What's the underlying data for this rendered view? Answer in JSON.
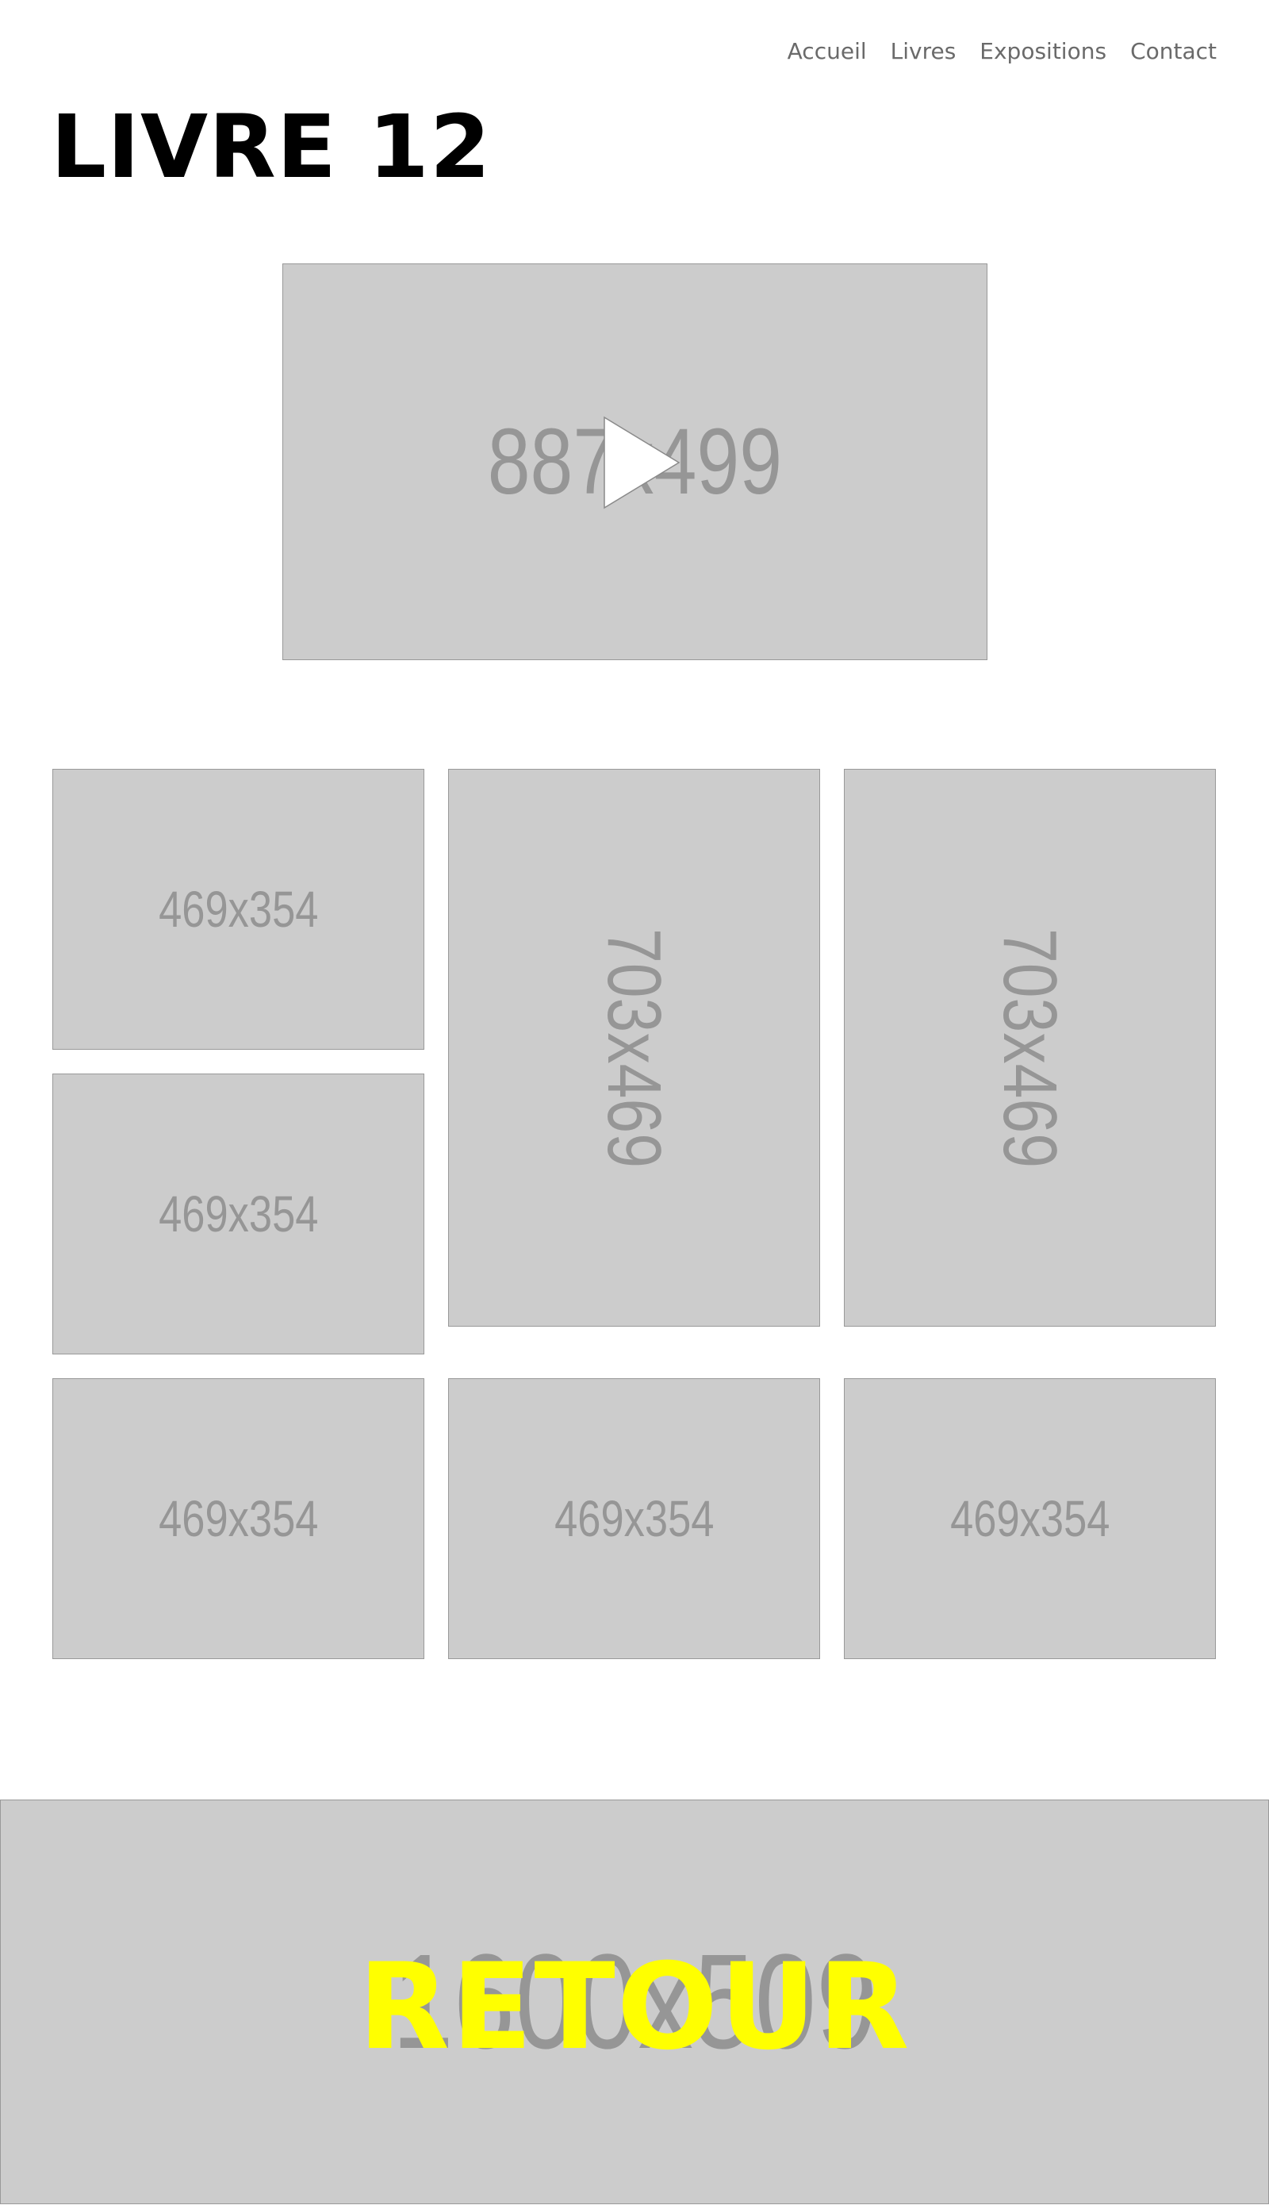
{
  "nav": {
    "items": [
      {
        "label": "Accueil"
      },
      {
        "label": "Livres"
      },
      {
        "label": "Expositions"
      },
      {
        "label": "Contact"
      }
    ]
  },
  "page": {
    "title": "LIVRE 12"
  },
  "video": {
    "placeholder_label": "887x499"
  },
  "gallery": {
    "items": [
      {
        "label": "469x354"
      },
      {
        "label": "703x469"
      },
      {
        "label": "703x469"
      },
      {
        "label": "469x354"
      },
      {
        "label": "469x354"
      },
      {
        "label": "469x354"
      },
      {
        "label": "469x354"
      }
    ]
  },
  "banner": {
    "placeholder_label": "1600x509",
    "link_label": "RETOUR",
    "link_color": "#ffff00"
  },
  "colors": {
    "placeholder_bg": "#cccccc",
    "placeholder_text": "#969696",
    "nav_text": "#6a6a6a"
  }
}
